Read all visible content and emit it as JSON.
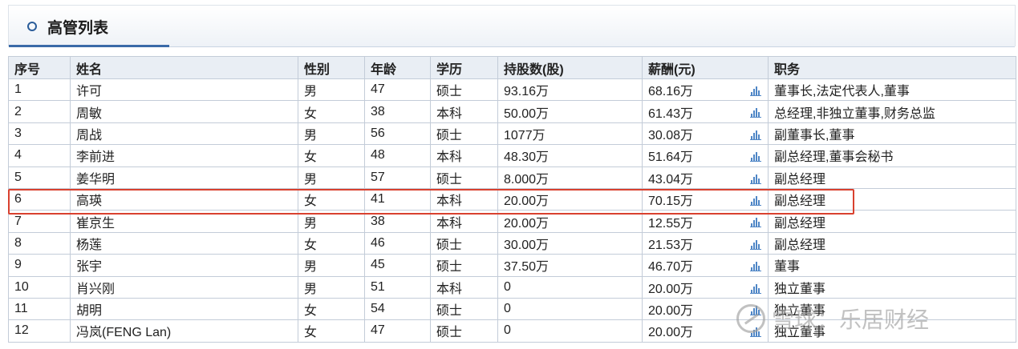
{
  "panel": {
    "title": "高管列表"
  },
  "table": {
    "headers": [
      "序号",
      "姓名",
      "性别",
      "年龄",
      "学历",
      "持股数(股)",
      "薪酬(元)",
      "职务"
    ],
    "rows": [
      [
        "1",
        "许可",
        "男",
        "47",
        "硕士",
        "93.16万",
        "68.16万",
        "董事长,法定代表人,董事"
      ],
      [
        "2",
        "周敏",
        "女",
        "38",
        "本科",
        "50.00万",
        "61.43万",
        "总经理,非独立董事,财务总监"
      ],
      [
        "3",
        "周战",
        "男",
        "56",
        "硕士",
        "1077万",
        "30.08万",
        "副董事长,董事"
      ],
      [
        "4",
        "李前进",
        "女",
        "48",
        "本科",
        "48.30万",
        "51.64万",
        "副总经理,董事会秘书"
      ],
      [
        "5",
        "姜华明",
        "男",
        "57",
        "硕士",
        "8.000万",
        "43.04万",
        "副总经理"
      ],
      [
        "6",
        "高瑛",
        "女",
        "41",
        "本科",
        "20.00万",
        "70.15万",
        "副总经理"
      ],
      [
        "7",
        "崔京生",
        "男",
        "38",
        "本科",
        "20.00万",
        "12.55万",
        "副总经理"
      ],
      [
        "8",
        "杨莲",
        "女",
        "46",
        "硕士",
        "30.00万",
        "21.53万",
        "副总经理"
      ],
      [
        "9",
        "张宇",
        "男",
        "45",
        "硕士",
        "37.50万",
        "46.70万",
        "董事"
      ],
      [
        "10",
        "肖兴刚",
        "男",
        "51",
        "本科",
        "0",
        "20.00万",
        "独立董事"
      ],
      [
        "11",
        "胡明",
        "女",
        "54",
        "硕士",
        "0",
        "20.00万",
        "独立董事"
      ],
      [
        "12",
        "冯岚(FENG Lan)",
        "女",
        "47",
        "硕士",
        "0",
        "20.00万",
        "独立董事"
      ]
    ],
    "highlighted_row": 6
  },
  "icons": {
    "salary_chart": "bar-chart-icon",
    "header_bullet": "circle-icon"
  },
  "colors": {
    "accent": "#2b5d9a",
    "highlight": "#d9412f",
    "header_bg": "#e9eef4"
  },
  "watermark": {
    "text": "雪球：乐居财经"
  }
}
